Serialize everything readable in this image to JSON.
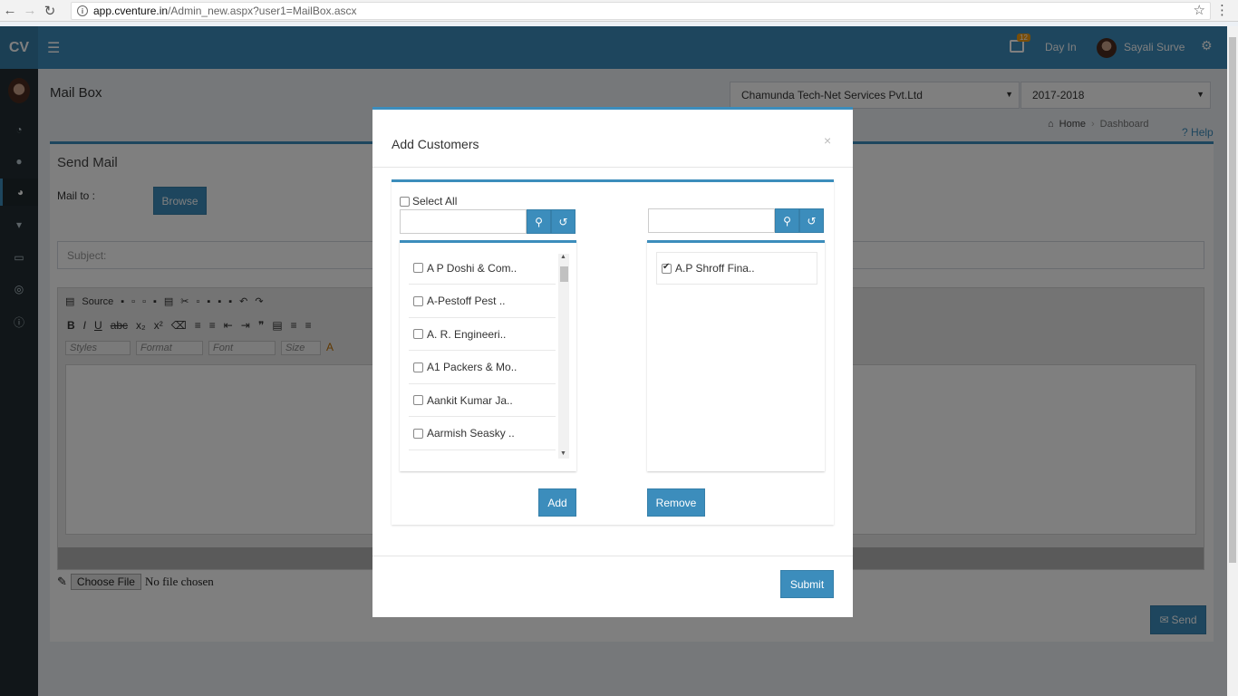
{
  "browser": {
    "url_host": "app.cventure.in",
    "url_path": "/Admin_new.aspx?user1=MailBox.ascx"
  },
  "header": {
    "logo": "CV",
    "notification_count": "12",
    "day_in_label": "Day In",
    "user_name": "Sayali Surve"
  },
  "page": {
    "title": "Mail Box",
    "company_select": "Chamunda Tech-Net Services Pvt.Ltd",
    "year_select": "2017-2018",
    "breadcrumb_home": "Home",
    "breadcrumb_current": "Dashboard",
    "help_label": "Help"
  },
  "mail_form": {
    "box_title": "Send Mail",
    "mailto_label": "Mail to :",
    "browse_label": "Browse",
    "subject_placeholder": "Subject:",
    "toolbar_source": "Source",
    "combo_styles": "Styles",
    "combo_format": "Format",
    "combo_font": "Font",
    "combo_size": "Size",
    "choose_file_label": "Choose File",
    "no_file_text": "No file chosen",
    "send_label": "Send"
  },
  "modal": {
    "title": "Add Customers",
    "close_glyph": "×",
    "select_all_label": "Select All",
    "available_customers": [
      "A P Doshi & Com..",
      "A-Pestoff Pest ..",
      "A. R. Engineeri..",
      "A1 Packers & Mo..",
      "Aankit Kumar Ja..",
      "Aarmish Seasky .."
    ],
    "selected_customers": [
      "A.P Shroff Fina.."
    ],
    "add_label": "Add",
    "remove_label": "Remove",
    "submit_label": "Submit"
  }
}
